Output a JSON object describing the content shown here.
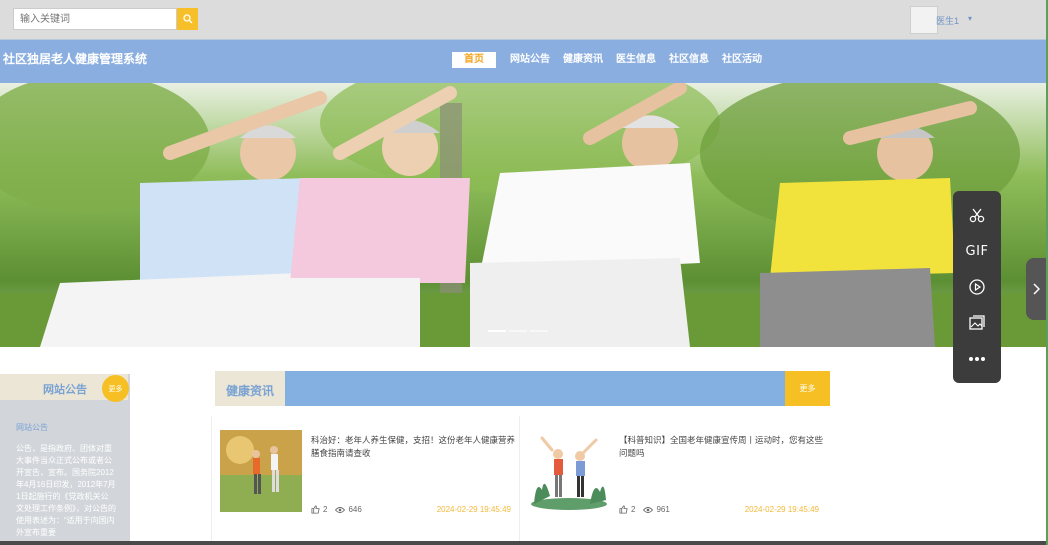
{
  "topbar": {
    "search_placeholder": "输入关键词",
    "user_name": "医生1",
    "user_caret": "▾"
  },
  "header": {
    "site_title": "社区独居老人健康管理系统"
  },
  "nav": {
    "items": [
      {
        "label": "首页",
        "active": true
      },
      {
        "label": "网站公告"
      },
      {
        "label": "健康资讯"
      },
      {
        "label": "医生信息"
      },
      {
        "label": "社区信息"
      },
      {
        "label": "社区活动"
      }
    ]
  },
  "float_toolbar": {
    "gif_label": "GIF",
    "icons": [
      "scissors-icon",
      "gif-icon",
      "play-icon",
      "image-icon",
      "more-icon"
    ]
  },
  "announcement": {
    "title": "网站公告",
    "more_label": "更多",
    "subtitle": "网站公告",
    "body": "公告，是指政府、团体对重大事件当众正式公布或者公开宣告，宣布。国务院2012年4月16日印发，2012年7月1日起施行的《党政机关公文处理工作条例》，对公告的使用表述为：“适用于向国内外宣布重要"
  },
  "health_news": {
    "title": "健康资讯",
    "more_label": "更多",
    "cards": [
      {
        "title": "科治好：老年人养生保健，支招！这份老年人健康营养膳食指南请查收",
        "likes": "2",
        "views": "646",
        "date": "2024-02-29 19:45:49"
      },
      {
        "title": "【科普知识】全国老年健康宣传周丨运动时，您有这些问题吗",
        "likes": "2",
        "views": "961",
        "date": "2024-02-29 19:45:49"
      }
    ]
  },
  "colors": {
    "nav_blue": "#8aaee0",
    "accent_yellow": "#f6c024",
    "title_blue": "#7aa3d4"
  }
}
